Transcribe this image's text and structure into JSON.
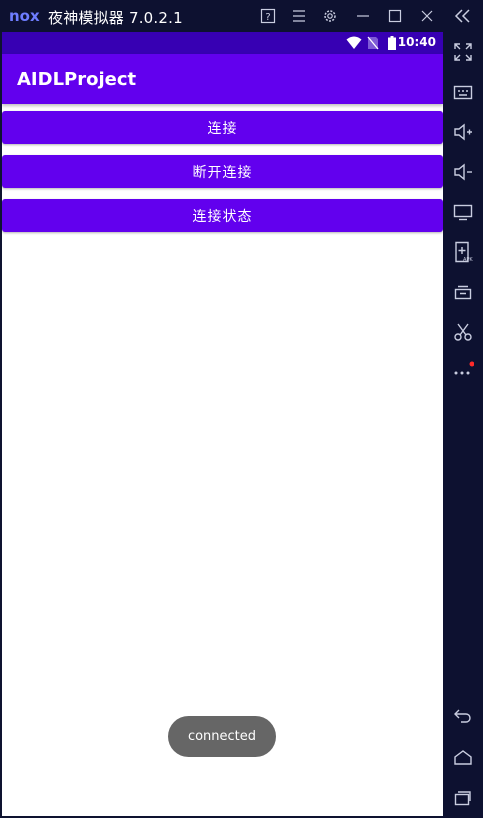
{
  "window": {
    "title": "夜神模拟器 7.0.2.1",
    "title_buttons": [
      "help-icon",
      "menu-icon",
      "settings-icon",
      "minimize-icon",
      "maximize-icon",
      "close-icon"
    ]
  },
  "side_toolbar": {
    "collapse_icon": "double-chevron-left-icon",
    "items": [
      "fullscreen-icon",
      "keyboard-icon",
      "volume-up-icon",
      "volume-down-icon",
      "screen-icon",
      "install-apk-icon",
      "multi-instance-icon",
      "scissors-icon",
      "more-icon"
    ],
    "nav": [
      "back-icon",
      "home-icon",
      "recents-icon"
    ]
  },
  "status_bar": {
    "time": "10:40",
    "icons": [
      "wifi-icon",
      "no-sim-icon",
      "battery-icon"
    ]
  },
  "app": {
    "title": "AIDLProject",
    "buttons": {
      "connect": "连接",
      "disconnect": "断开连接",
      "status": "连接状态"
    },
    "toast": "connected"
  },
  "colors": {
    "primary": "#6200ee",
    "status_bar": "#3700b3",
    "emulator_frame": "#0d1130",
    "toast_bg": "#666666"
  }
}
